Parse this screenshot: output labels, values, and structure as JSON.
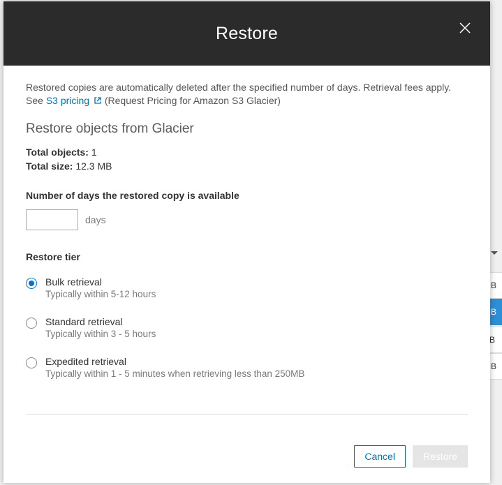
{
  "header": {
    "title": "Restore"
  },
  "intro": {
    "text_before_link": "Restored copies are automatically deleted after the specified number of days. Retrieval fees apply. See ",
    "link_text": "S3 pricing",
    "text_after_link": " (Request Pricing for Amazon S3 Glacier)"
  },
  "section": {
    "title": "Restore objects from Glacier",
    "total_objects_label": "Total objects:",
    "total_objects_value": "1",
    "total_size_label": "Total size:",
    "total_size_value": "12.3 MB"
  },
  "form": {
    "days_label": "Number of days the restored copy is available",
    "days_value": "",
    "days_unit": "days",
    "tier_label": "Restore tier"
  },
  "tiers": {
    "bulk": {
      "title": "Bulk retrieval",
      "sub": "Typically within 5-12 hours",
      "selected": true
    },
    "standard": {
      "title": "Standard retrieval",
      "sub": "Typically within 3 - 5 hours",
      "selected": false
    },
    "expedited": {
      "title": "Expedited retrieval",
      "sub": "Typically within 1 - 5 minutes when retrieving less than 250MB",
      "selected": false
    }
  },
  "footer": {
    "cancel": "Cancel",
    "restore": "Restore"
  },
  "background": {
    "row1": "MB",
    "row2": "MB",
    "row3": "KB",
    "row4": "MB"
  }
}
